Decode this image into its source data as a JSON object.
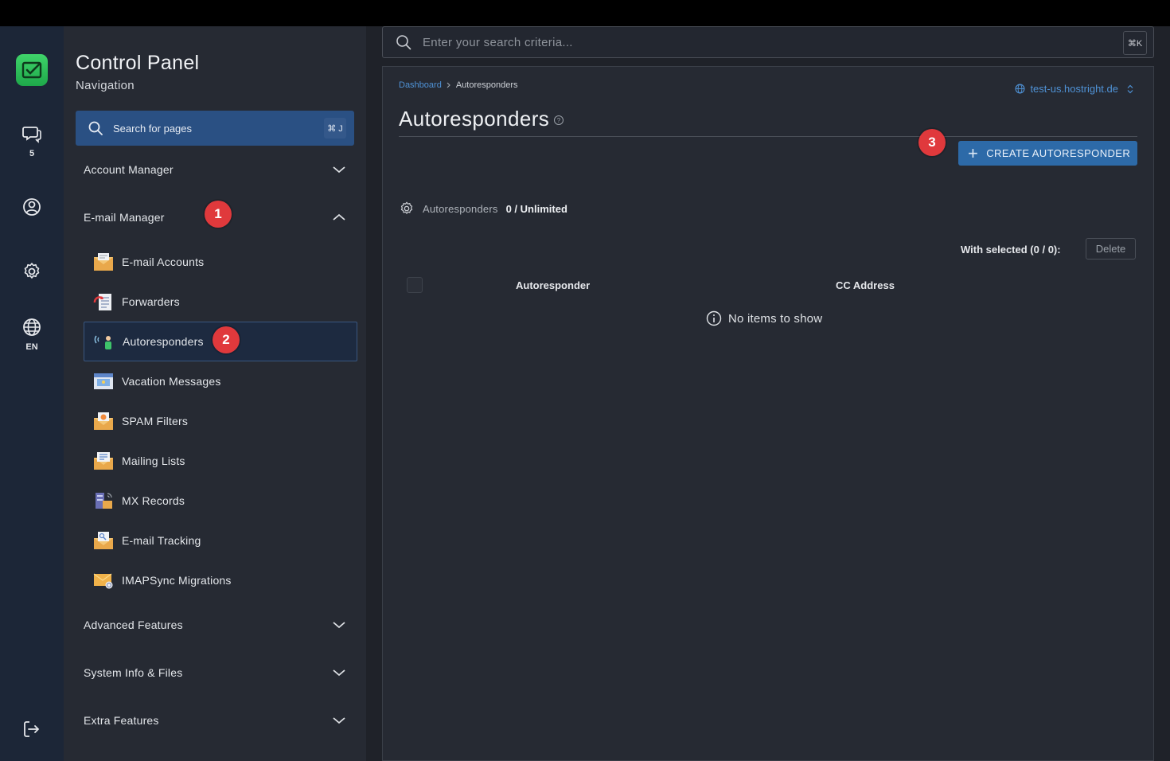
{
  "rail": {
    "tickets_count": "5",
    "language": "EN"
  },
  "sidebar": {
    "title": "Control Panel",
    "subtitle": "Navigation",
    "search_label": "Search for pages",
    "search_kbd": "⌘ J",
    "sections": {
      "account_manager": "Account Manager",
      "email_manager": "E-mail Manager",
      "advanced_features": "Advanced Features",
      "system_info": "System Info & Files",
      "extra_features": "Extra Features"
    },
    "items": [
      {
        "label": "E-mail Accounts",
        "icon": "email-accounts-icon"
      },
      {
        "label": "Forwarders",
        "icon": "forwarders-icon"
      },
      {
        "label": "Autoresponders",
        "icon": "autoresponders-icon",
        "active": true
      },
      {
        "label": "Vacation Messages",
        "icon": "vacation-messages-icon"
      },
      {
        "label": "SPAM Filters",
        "icon": "spam-filters-icon"
      },
      {
        "label": "Mailing Lists",
        "icon": "mailing-lists-icon"
      },
      {
        "label": "MX Records",
        "icon": "mx-records-icon"
      },
      {
        "label": "E-mail Tracking",
        "icon": "email-tracking-icon"
      },
      {
        "label": "IMAPSync Migrations",
        "icon": "imapsync-icon"
      }
    ]
  },
  "annotations": {
    "step1": "1",
    "step2": "2",
    "step3": "3"
  },
  "topsearch": {
    "placeholder": "Enter your search criteria...",
    "kbd": "⌘K"
  },
  "main": {
    "breadcrumb": {
      "home": "Dashboard",
      "current": "Autoresponders"
    },
    "server": "test-us.hostright.de",
    "title": "Autoresponders",
    "help_glyph": "?",
    "create_button": "CREATE AUTORESPONDER",
    "quota_label": "Autoresponders",
    "quota_value": "0 / Unlimited",
    "with_selected": "With selected (0 / 0):",
    "delete_button": "Delete",
    "columns": [
      "Autoresponder",
      "CC Address"
    ],
    "empty_message": "No items to show"
  },
  "colors": {
    "accent": "#2d6aa8",
    "link": "#4f92d6",
    "badge": "#e0393c",
    "logo": "#2fc35a"
  }
}
